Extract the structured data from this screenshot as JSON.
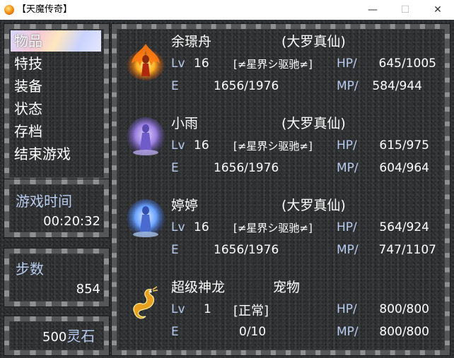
{
  "window": {
    "title": "【天魔传奇】",
    "minimize_glyph": "—",
    "maximize_glyph": "☐",
    "close_glyph": "✕"
  },
  "menu": {
    "items": [
      {
        "label": "物品",
        "selected": true
      },
      {
        "label": "特技",
        "selected": false
      },
      {
        "label": "装备",
        "selected": false
      },
      {
        "label": "状态",
        "selected": false
      },
      {
        "label": "存档",
        "selected": false
      },
      {
        "label": "结束游戏",
        "selected": false
      }
    ]
  },
  "playtime": {
    "label": "游戏时间",
    "value": "00:20:32"
  },
  "steps": {
    "label": "步数",
    "value": "854"
  },
  "currency": {
    "amount": "500",
    "unit": "灵石"
  },
  "party": [
    {
      "name": "余璟舟",
      "title": "(大罗真仙)",
      "lv_label": "Lv",
      "level": "16",
      "state": "[≠星界シ驱驰≠]",
      "hp_label": "HP/",
      "hp": "645/1005",
      "e_label": "E",
      "exp": "1656/1976",
      "mp_label": "MP/",
      "mp": "584/944",
      "portrait": "fire-spirit"
    },
    {
      "name": "小雨",
      "title": "(大罗真仙)",
      "lv_label": "Lv",
      "level": "16",
      "state": "[≠星界シ驱驰≠]",
      "hp_label": "HP/",
      "hp": "615/975",
      "e_label": "E",
      "exp": "1656/1976",
      "mp_label": "MP/",
      "mp": "604/964",
      "portrait": "violet-spirit"
    },
    {
      "name": "婷婷",
      "title": "(大罗真仙)",
      "lv_label": "Lv",
      "level": "16",
      "state": "[≠星界シ驱驰≠]",
      "hp_label": "HP/",
      "hp": "564/924",
      "e_label": "E",
      "exp": "1656/1976",
      "mp_label": "MP/",
      "mp": "747/1107",
      "portrait": "blue-spirit"
    },
    {
      "name": "超级神龙",
      "title": "宠物",
      "lv_label": "Lv",
      "level": "1",
      "state": "[正常]",
      "hp_label": "HP/",
      "hp": "800/800",
      "e_label": "E",
      "exp": "0/10",
      "mp_label": "MP/",
      "mp": "800/800",
      "portrait": "golden-dragon"
    }
  ],
  "colors": {
    "label_blue": "#b9ccf1",
    "text_white": "#ffffff",
    "frame_grey": "#8e9092",
    "panel_bg": "#2c2e2f"
  }
}
